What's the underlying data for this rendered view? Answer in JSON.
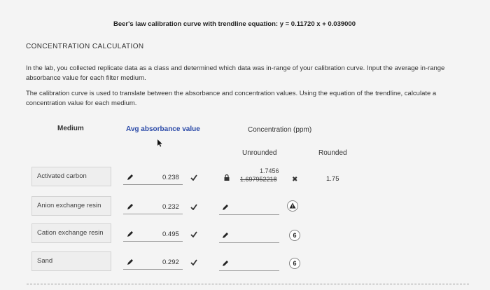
{
  "header": {
    "equation_title": "Beer's law calibration curve with trendline equation: y = 0.11720 x + 0.039000"
  },
  "section": {
    "title": "CONCENTRATION CALCULATION",
    "para1": "In the lab, you collected replicate data as a class and determined which data was in-range of your calibration curve. Input the average in-range absorbance value for each filter medium.",
    "para2": "The calibration curve is used to translate between the absorbance and concentration values. Using the equation of the trendline, calculate a concentration value for each medium."
  },
  "table": {
    "col_medium": "Medium",
    "col_avg_abs": "Avg absorbance value",
    "col_concentration": "Concentration (ppm)",
    "col_unrounded": "Unrounded",
    "col_rounded": "Rounded",
    "rows": [
      {
        "medium": "Activated carbon",
        "absorbance": "0.238",
        "unrounded_correction": "1.7456",
        "unrounded_value": "1.697952218",
        "rounded": "1.75"
      },
      {
        "medium": "Anion exchange resin",
        "absorbance": "0.232"
      },
      {
        "medium": "Cation exchange resin",
        "absorbance": "0.495",
        "badge": "6"
      },
      {
        "medium": "Sand",
        "absorbance": "0.292",
        "badge": "6"
      }
    ]
  },
  "icons": {
    "pencil": "pencil-icon",
    "check": "check-icon",
    "lock": "lock-icon",
    "cross": "x-mark-icon",
    "warning": "warning-icon",
    "cursor": "cursor-icon"
  },
  "marks": {
    "cross": "✖"
  },
  "colors": {
    "accent_blue": "#2b4aa8",
    "background": "#f4f4f4"
  }
}
